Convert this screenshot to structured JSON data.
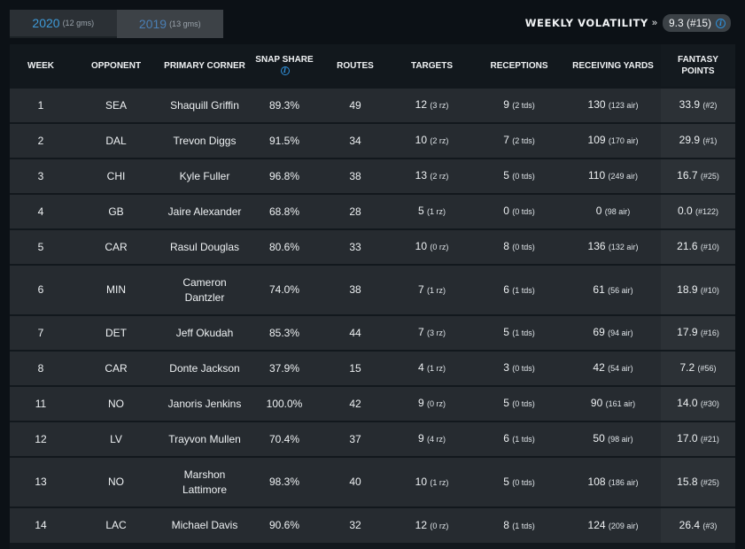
{
  "season_tabs": [
    {
      "year": "2020",
      "games": "(12 gms)",
      "active": true
    },
    {
      "year": "2019",
      "games": "(13 gms)",
      "active": false
    }
  ],
  "volatility": {
    "label": "Weekly Volatility",
    "arrow": "»",
    "value": "9.3 (#15)"
  },
  "icons": {
    "info": "info-icon",
    "arrow": "double-chevron-right"
  },
  "colors": {
    "accent": "#3e9ad8",
    "background": "#12181d",
    "row": "#262b30"
  },
  "table": {
    "headers": {
      "week": "WEEK",
      "opponent": "OPPONENT",
      "corner": "PRIMARY CORNER",
      "snap": "SNAP SHARE",
      "routes": "ROUTES",
      "targets": "TARGETS",
      "receptions": "RECEPTIONS",
      "yards": "RECEIVING YARDS",
      "points_line1": "FANTASY",
      "points_line2": "POINTS"
    },
    "rows": [
      {
        "week": "1",
        "opp": "SEA",
        "corner1": "Shaquill Griffin",
        "corner2": "",
        "snap": "89.3%",
        "routes": "49",
        "targets": "12",
        "targets_sub": "(3 rz)",
        "rec": "9",
        "rec_sub": "(2 tds)",
        "yards": "130",
        "yards_sub": "(123 air)",
        "pts": "33.9",
        "pts_sub": "(#2)"
      },
      {
        "week": "2",
        "opp": "DAL",
        "corner1": "Trevon Diggs",
        "corner2": "",
        "snap": "91.5%",
        "routes": "34",
        "targets": "10",
        "targets_sub": "(2 rz)",
        "rec": "7",
        "rec_sub": "(2 tds)",
        "yards": "109",
        "yards_sub": "(170 air)",
        "pts": "29.9",
        "pts_sub": "(#1)"
      },
      {
        "week": "3",
        "opp": "CHI",
        "corner1": "Kyle Fuller",
        "corner2": "",
        "snap": "96.8%",
        "routes": "38",
        "targets": "13",
        "targets_sub": "(2 rz)",
        "rec": "5",
        "rec_sub": "(0 tds)",
        "yards": "110",
        "yards_sub": "(249 air)",
        "pts": "16.7",
        "pts_sub": "(#25)"
      },
      {
        "week": "4",
        "opp": "GB",
        "corner1": "Jaire Alexander",
        "corner2": "",
        "snap": "68.8%",
        "routes": "28",
        "targets": "5",
        "targets_sub": "(1 rz)",
        "rec": "0",
        "rec_sub": "(0 tds)",
        "yards": "0",
        "yards_sub": "(98 air)",
        "pts": "0.0",
        "pts_sub": "(#122)"
      },
      {
        "week": "5",
        "opp": "CAR",
        "corner1": "Rasul Douglas",
        "corner2": "",
        "snap": "80.6%",
        "routes": "33",
        "targets": "10",
        "targets_sub": "(0 rz)",
        "rec": "8",
        "rec_sub": "(0 tds)",
        "yards": "136",
        "yards_sub": "(132 air)",
        "pts": "21.6",
        "pts_sub": "(#10)"
      },
      {
        "week": "6",
        "opp": "MIN",
        "corner1": "Cameron",
        "corner2": "Dantzler",
        "snap": "74.0%",
        "routes": "38",
        "targets": "7",
        "targets_sub": "(1 rz)",
        "rec": "6",
        "rec_sub": "(1 tds)",
        "yards": "61",
        "yards_sub": "(56 air)",
        "pts": "18.9",
        "pts_sub": "(#10)"
      },
      {
        "week": "7",
        "opp": "DET",
        "corner1": "Jeff Okudah",
        "corner2": "",
        "snap": "85.3%",
        "routes": "44",
        "targets": "7",
        "targets_sub": "(3 rz)",
        "rec": "5",
        "rec_sub": "(1 tds)",
        "yards": "69",
        "yards_sub": "(94 air)",
        "pts": "17.9",
        "pts_sub": "(#16)"
      },
      {
        "week": "8",
        "opp": "CAR",
        "corner1": "Donte Jackson",
        "corner2": "",
        "snap": "37.9%",
        "routes": "15",
        "targets": "4",
        "targets_sub": "(1 rz)",
        "rec": "3",
        "rec_sub": "(0 tds)",
        "yards": "42",
        "yards_sub": "(54 air)",
        "pts": "7.2",
        "pts_sub": "(#56)"
      },
      {
        "week": "11",
        "opp": "NO",
        "corner1": "Janoris Jenkins",
        "corner2": "",
        "snap": "100.0%",
        "routes": "42",
        "targets": "9",
        "targets_sub": "(0 rz)",
        "rec": "5",
        "rec_sub": "(0 tds)",
        "yards": "90",
        "yards_sub": "(161 air)",
        "pts": "14.0",
        "pts_sub": "(#30)"
      },
      {
        "week": "12",
        "opp": "LV",
        "corner1": "Trayvon Mullen",
        "corner2": "",
        "snap": "70.4%",
        "routes": "37",
        "targets": "9",
        "targets_sub": "(4 rz)",
        "rec": "6",
        "rec_sub": "(1 tds)",
        "yards": "50",
        "yards_sub": "(98 air)",
        "pts": "17.0",
        "pts_sub": "(#21)"
      },
      {
        "week": "13",
        "opp": "NO",
        "corner1": "Marshon",
        "corner2": "Lattimore",
        "snap": "98.3%",
        "routes": "40",
        "targets": "10",
        "targets_sub": "(1 rz)",
        "rec": "5",
        "rec_sub": "(0 tds)",
        "yards": "108",
        "yards_sub": "(186 air)",
        "pts": "15.8",
        "pts_sub": "(#25)"
      },
      {
        "week": "14",
        "opp": "LAC",
        "corner1": "Michael Davis",
        "corner2": "",
        "snap": "90.6%",
        "routes": "32",
        "targets": "12",
        "targets_sub": "(0 rz)",
        "rec": "8",
        "rec_sub": "(1 tds)",
        "yards": "124",
        "yards_sub": "(209 air)",
        "pts": "26.4",
        "pts_sub": "(#3)"
      }
    ]
  }
}
